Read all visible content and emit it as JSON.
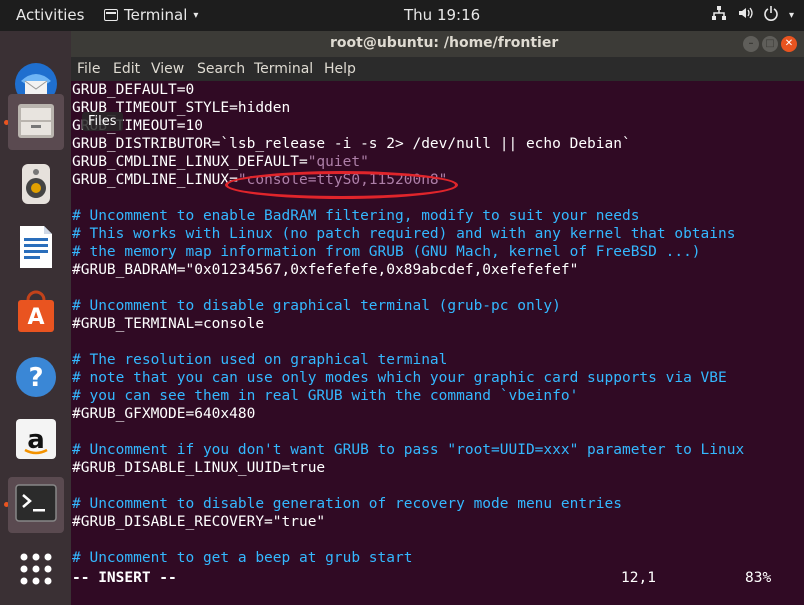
{
  "topbar": {
    "activities": "Activities",
    "app_name": "Terminal",
    "app_caret": "▾",
    "clock": "Thu 19:16",
    "status_icons": [
      "network-icon",
      "volume-icon",
      "power-icon",
      "caret-down-icon"
    ]
  },
  "dock": {
    "items": [
      "thunderbird",
      "files",
      "rhythmbox",
      "libreoffice-writer",
      "ubuntu-software",
      "help",
      "amazon",
      "terminal",
      "show-applications"
    ],
    "tooltip": "Files"
  },
  "window": {
    "title": "root@ubuntu: /home/frontier",
    "menu": [
      "File",
      "Edit",
      "View",
      "Search",
      "Terminal",
      "Help"
    ]
  },
  "editor": {
    "lines": [
      {
        "segments": [
          {
            "t": "GRUB_DEFAULT=0",
            "c": ""
          }
        ]
      },
      {
        "segments": [
          {
            "t": "GRUB_TIMEOUT_STYLE=hidden",
            "c": ""
          }
        ]
      },
      {
        "segments": [
          {
            "t": "GRUB_TIMEOUT=10",
            "c": ""
          }
        ]
      },
      {
        "segments": [
          {
            "t": "GRUB_DISTRIBUTOR=`lsb_release -i -s 2> /dev/null || echo Debian`",
            "c": ""
          }
        ]
      },
      {
        "segments": [
          {
            "t": "GRUB_CMDLINE_LINUX_DEFAULT=",
            "c": ""
          },
          {
            "t": "\"quiet\"",
            "c": "str"
          }
        ]
      },
      {
        "segments": [
          {
            "t": "GRUB_CMDLINE_LINUX=",
            "c": ""
          },
          {
            "t": "\"console=ttyS0,115200n8\"",
            "c": "str"
          }
        ]
      },
      {
        "segments": [
          {
            "t": "",
            "c": ""
          }
        ]
      },
      {
        "segments": [
          {
            "t": "# Uncomment to enable BadRAM filtering, modify to suit your needs",
            "c": "comment"
          }
        ]
      },
      {
        "segments": [
          {
            "t": "# This works with Linux (no patch required) and with any kernel that obtains",
            "c": "comment"
          }
        ]
      },
      {
        "segments": [
          {
            "t": "# the memory map information from GRUB (GNU Mach, kernel of FreeBSD ...)",
            "c": "comment"
          }
        ]
      },
      {
        "segments": [
          {
            "t": "#GRUB_BADRAM=\"0x01234567,0xfefefefe,0x89abcdef,0xefefefef\"",
            "c": ""
          }
        ]
      },
      {
        "segments": [
          {
            "t": "",
            "c": ""
          }
        ]
      },
      {
        "segments": [
          {
            "t": "# Uncomment to disable graphical terminal (grub-pc only)",
            "c": "comment"
          }
        ]
      },
      {
        "segments": [
          {
            "t": "#GRUB_TERMINAL=console",
            "c": ""
          }
        ]
      },
      {
        "segments": [
          {
            "t": "",
            "c": ""
          }
        ]
      },
      {
        "segments": [
          {
            "t": "# The resolution used on graphical terminal",
            "c": "comment"
          }
        ]
      },
      {
        "segments": [
          {
            "t": "# note that you can use only modes which your graphic card supports via VBE",
            "c": "comment"
          }
        ]
      },
      {
        "segments": [
          {
            "t": "# you can see them in real GRUB with the command `vbeinfo'",
            "c": "comment"
          }
        ]
      },
      {
        "segments": [
          {
            "t": "#GRUB_GFXMODE=640x480",
            "c": ""
          }
        ]
      },
      {
        "segments": [
          {
            "t": "",
            "c": ""
          }
        ]
      },
      {
        "segments": [
          {
            "t": "# Uncomment if you don't want GRUB to pass \"root=UUID=xxx\" parameter to Linux",
            "c": "comment"
          }
        ]
      },
      {
        "segments": [
          {
            "t": "#GRUB_DISABLE_LINUX_UUID=true",
            "c": ""
          }
        ]
      },
      {
        "segments": [
          {
            "t": "",
            "c": ""
          }
        ]
      },
      {
        "segments": [
          {
            "t": "# Uncomment to disable generation of recovery mode menu entries",
            "c": "comment"
          }
        ]
      },
      {
        "segments": [
          {
            "t": "#GRUB_DISABLE_RECOVERY=\"true\"",
            "c": ""
          }
        ]
      },
      {
        "segments": [
          {
            "t": "",
            "c": ""
          }
        ]
      },
      {
        "segments": [
          {
            "t": "# Uncomment to get a beep at grub start",
            "c": "comment"
          }
        ]
      }
    ],
    "status_mode": "-- INSERT --",
    "status_position": "12,1",
    "status_percent": "83%"
  },
  "colors": {
    "terminal_bg": "#300a24",
    "comment": "#34b8ff",
    "string": "#ad7fa8",
    "annotation": "#e0252b",
    "ubuntu_orange": "#e95420"
  }
}
